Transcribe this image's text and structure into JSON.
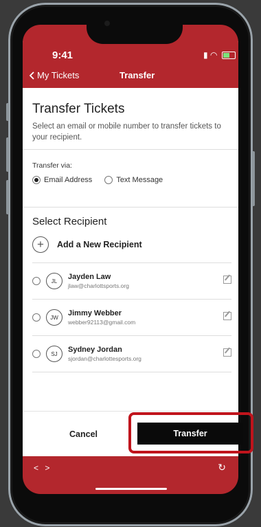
{
  "status_bar": {
    "time": "9:41"
  },
  "nav": {
    "back_label": "My Tickets",
    "title": "Transfer"
  },
  "header": {
    "title": "Transfer Tickets",
    "subtitle": "Select an email or mobile number to transfer tickets to your recipient."
  },
  "transfer_via": {
    "label": "Transfer via:",
    "options": [
      {
        "label": "Email Address",
        "selected": true
      },
      {
        "label": "Text Message",
        "selected": false
      }
    ]
  },
  "recipients": {
    "title": "Select Recipient",
    "add_label": "Add a New Recipient",
    "items": [
      {
        "initials": "JL",
        "name": "Jayden Law",
        "email": "jlaw@charlottsports.org"
      },
      {
        "initials": "JW",
        "name": "Jimmy Webber",
        "email": "webber92113@gmail.com"
      },
      {
        "initials": "SJ",
        "name": "Sydney Jordan",
        "email": "sjordan@charlottesports.org"
      }
    ]
  },
  "actions": {
    "cancel": "Cancel",
    "transfer": "Transfer"
  },
  "browser": {
    "arrows": "< >"
  },
  "colors": {
    "brand_red": "#b3272d",
    "highlight": "#c0141c",
    "button": "#0a0a0a"
  }
}
